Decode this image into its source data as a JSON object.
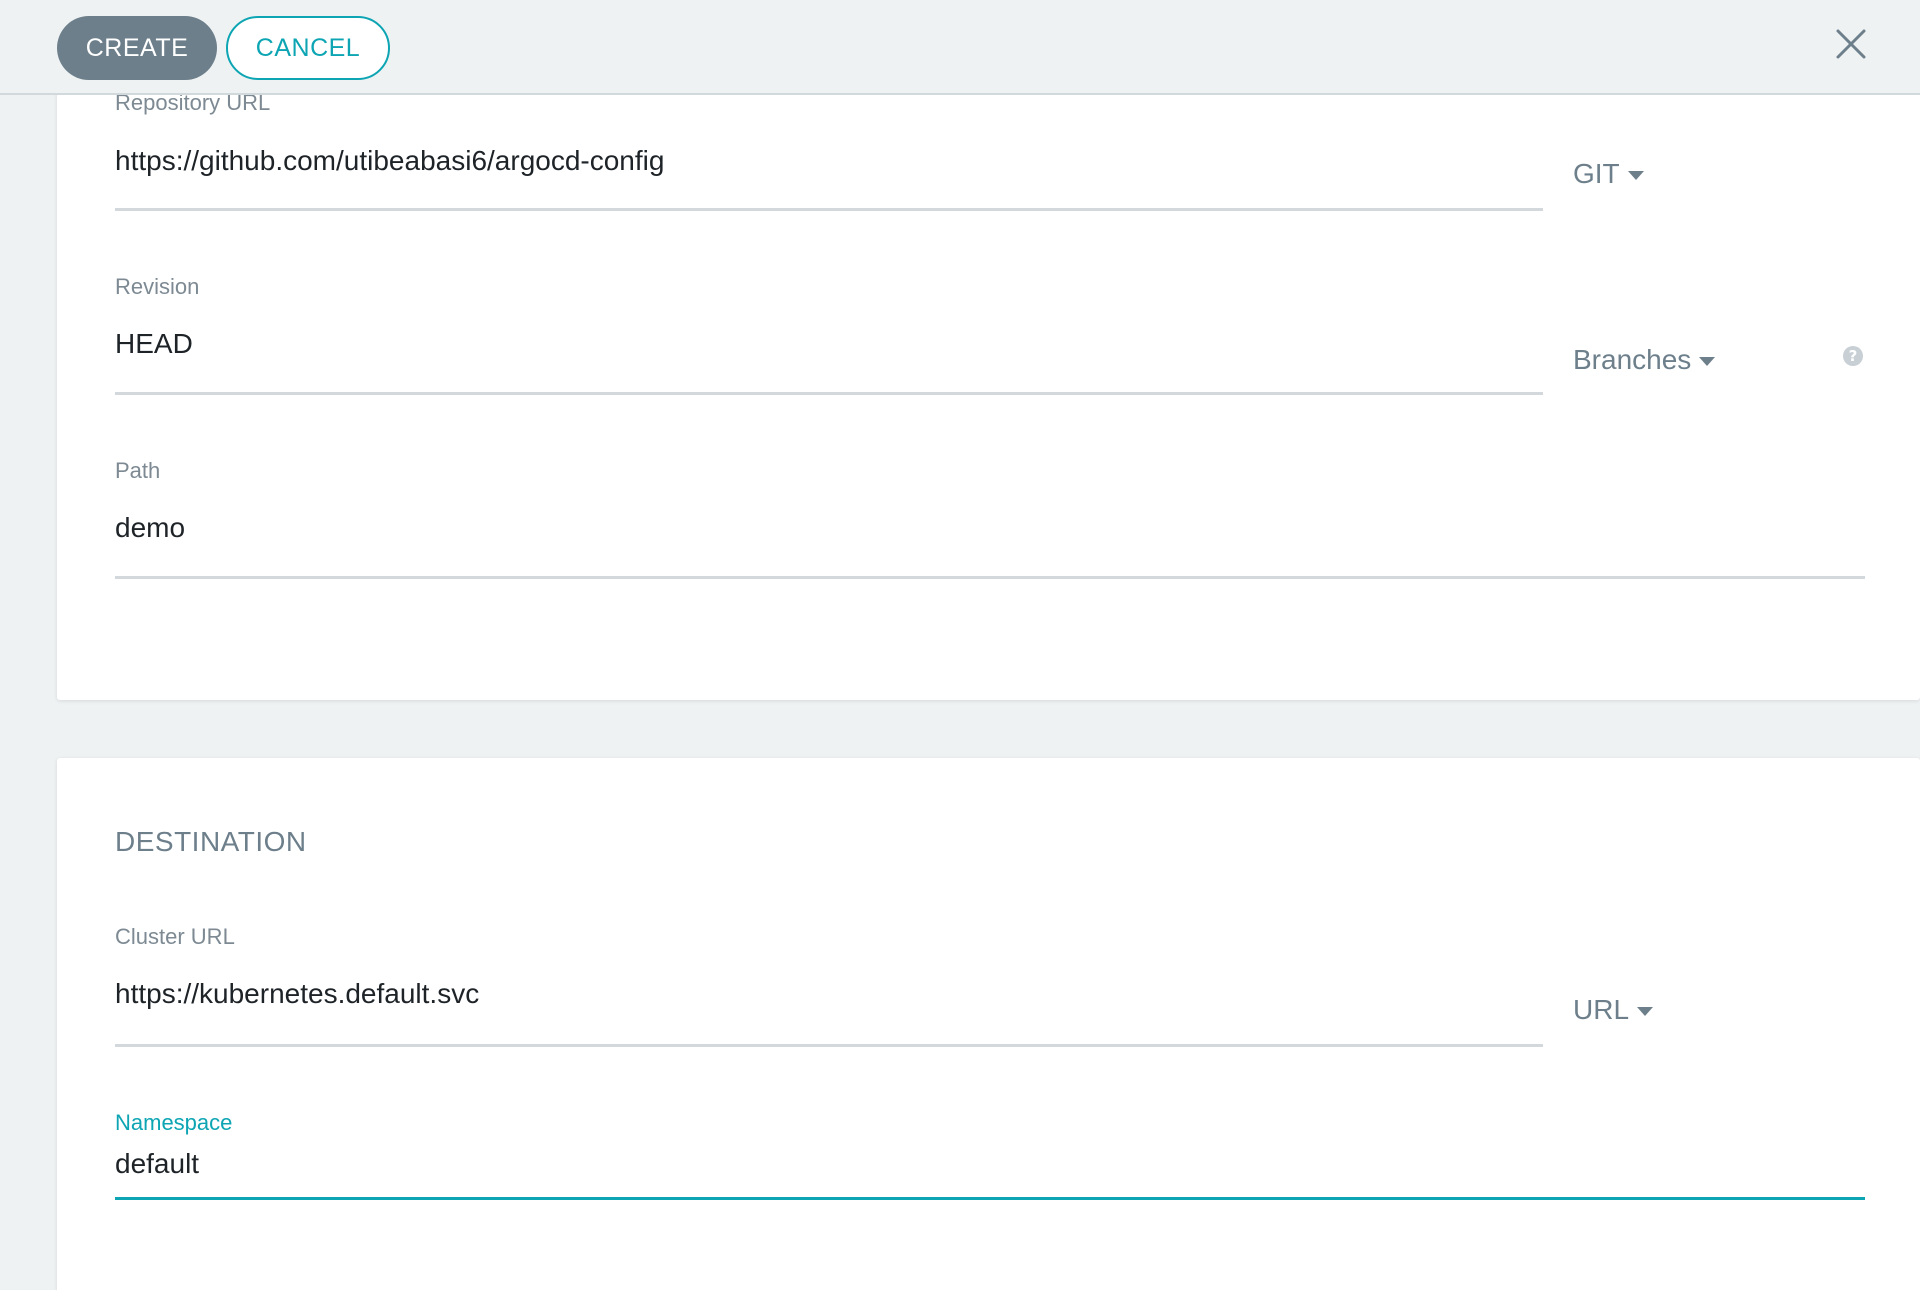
{
  "toolbar": {
    "create_label": "CREATE",
    "cancel_label": "CANCEL",
    "close_icon": "close-icon"
  },
  "source": {
    "repository_url": {
      "label": "Repository URL",
      "value": "https://github.com/utibeabasi6/argocd-config",
      "type_selector": "GIT"
    },
    "revision": {
      "label": "Revision",
      "value": "HEAD",
      "ref_selector": "Branches",
      "help_icon": "help-circle-icon"
    },
    "path": {
      "label": "Path",
      "value": "demo"
    }
  },
  "destination": {
    "section_title": "DESTINATION",
    "cluster_url": {
      "label": "Cluster URL",
      "value": "https://kubernetes.default.svc",
      "type_selector": "URL"
    },
    "namespace": {
      "label": "Namespace",
      "value": "default"
    }
  },
  "colors": {
    "accent": "#0da5b3",
    "create_button": "#6d7f8b",
    "background": "#eef2f3",
    "field_line": "#d3d8dc"
  }
}
